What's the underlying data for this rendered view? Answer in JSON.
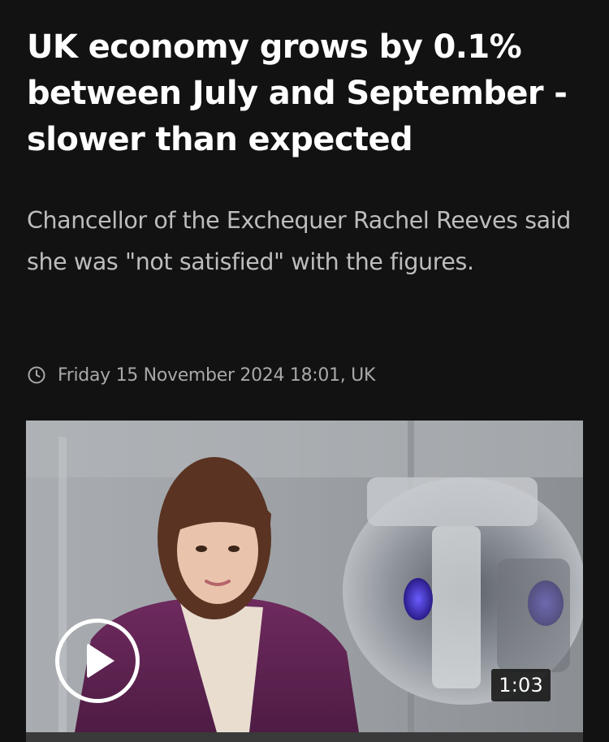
{
  "article": {
    "headline": "UK economy grows by 0.1% between July and September - slower than expected",
    "standfirst": "Chancellor of the Exchequer Rachel Reeves said she was \"not satisfied\" with the figures.",
    "timestamp": "Friday 15 November 2024 18:01, UK"
  },
  "video": {
    "duration": "1:03",
    "play_icon": "play-icon"
  },
  "icons": {
    "timestamp_icon": "clock-icon"
  },
  "colors": {
    "background": "#121212",
    "headline": "#ffffff",
    "standfirst": "#bdbdbd",
    "meta": "#a8a8a8"
  }
}
